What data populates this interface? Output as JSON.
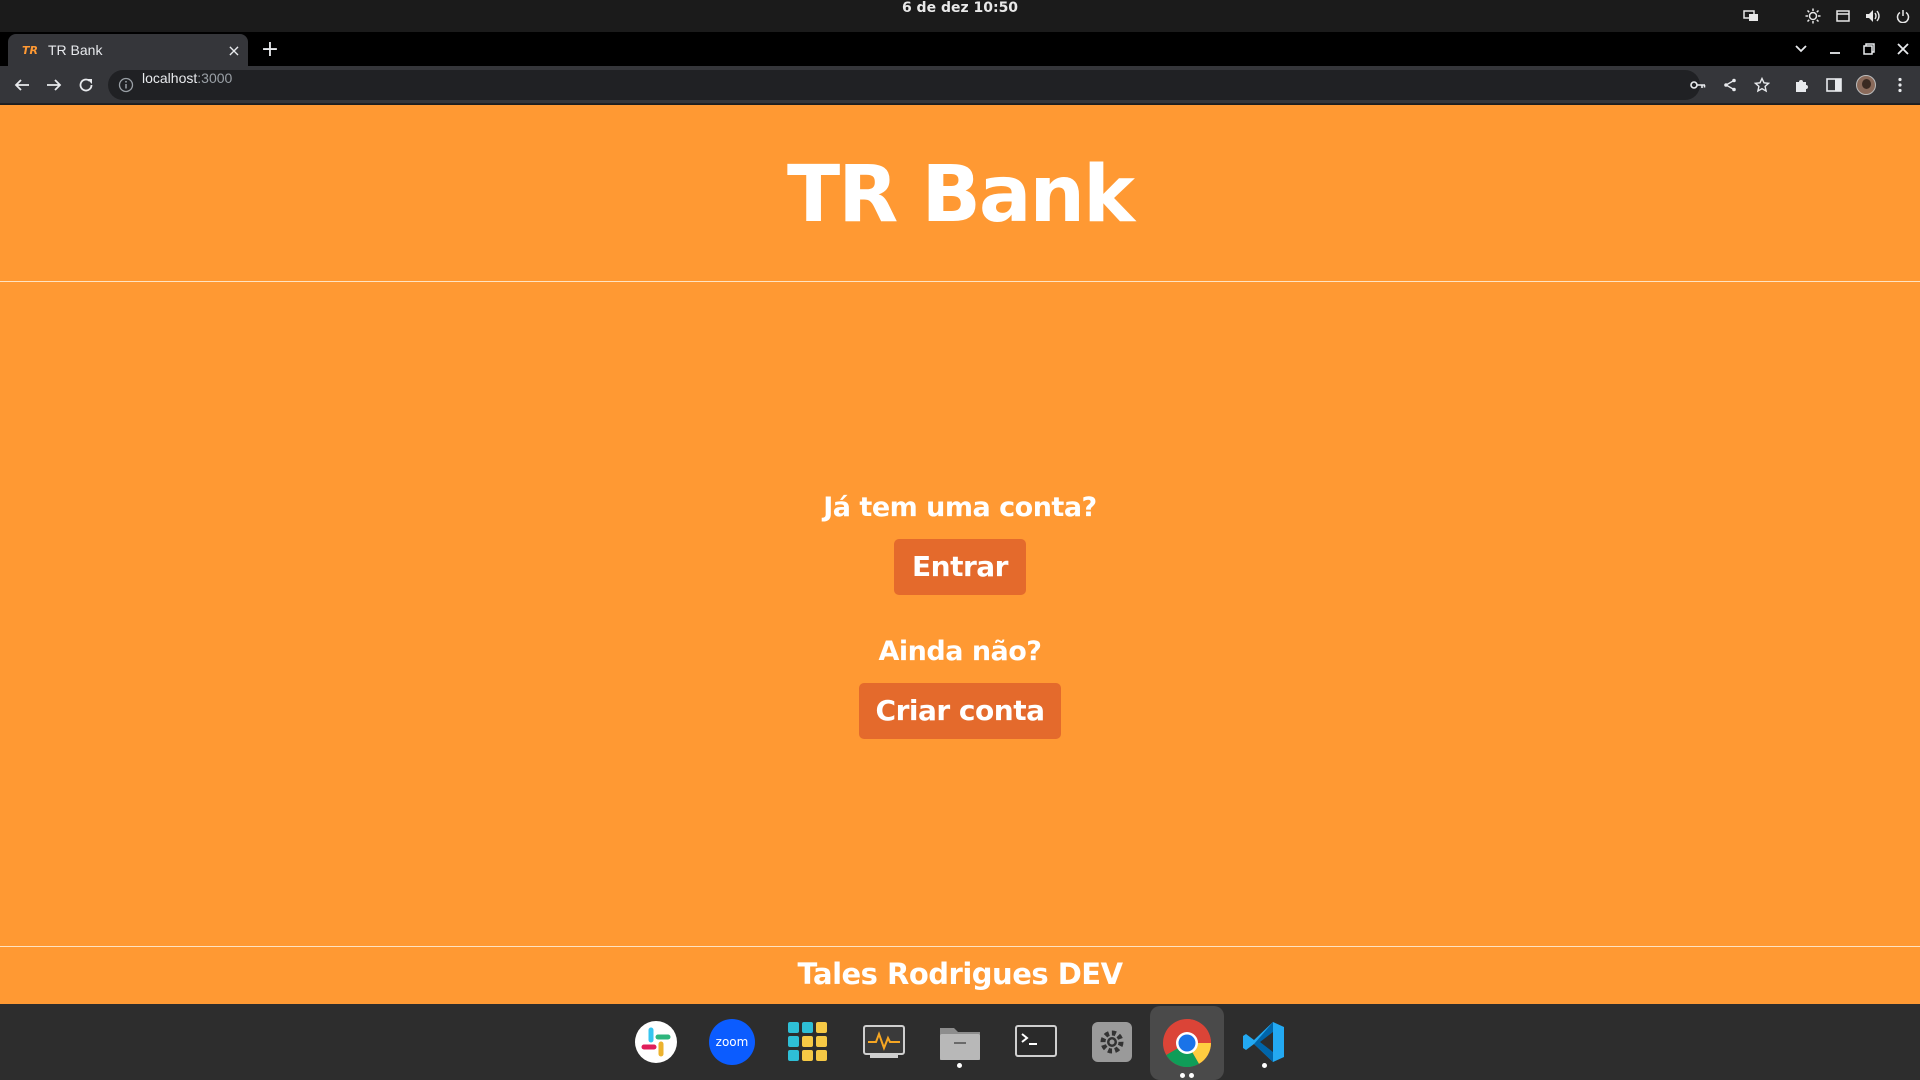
{
  "system": {
    "clock": "6 de dez  10:50",
    "tray_icons": [
      "display-icon",
      "brightness-icon",
      "window-icon",
      "volume-icon",
      "power-icon"
    ]
  },
  "browser": {
    "tab": {
      "favicon_text": "TR",
      "title": "TR Bank",
      "close": "×"
    },
    "new_tab": "+",
    "url_host": "localhost",
    "url_port": ":3000"
  },
  "page": {
    "brand": "TR Bank",
    "has_account_question": "Já tem uma conta?",
    "enter_button": "Entrar",
    "no_account_question": "Ainda não?",
    "create_account_button": "Criar conta",
    "footer": "Tales Rodrigues DEV"
  },
  "colors": {
    "page_background": "#ff9933",
    "button_background": "#e46a2c",
    "text": "#ffffff"
  },
  "dock": {
    "apps": [
      "slack-icon",
      "zoom-icon",
      "app-grid-icon",
      "system-monitor-icon",
      "files-icon",
      "terminal-icon",
      "settings-icon",
      "chrome-icon",
      "vscode-icon"
    ],
    "zoom_label": "zoom"
  }
}
